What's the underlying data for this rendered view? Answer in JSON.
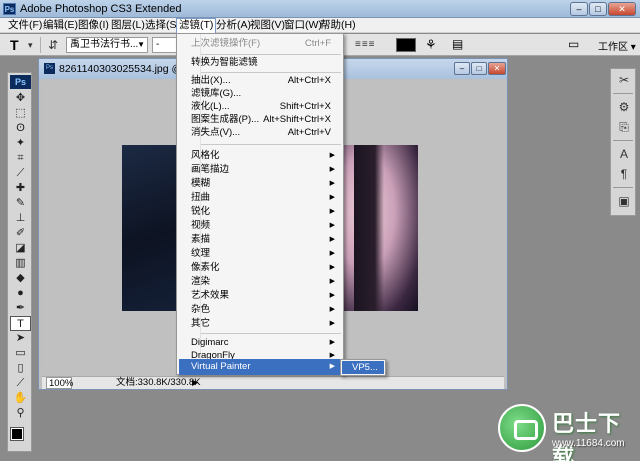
{
  "app": {
    "logo": "Ps",
    "title": "Adobe Photoshop CS3 Extended",
    "window_buttons": {
      "minimize": "–",
      "maximize": "□",
      "close": "✕"
    }
  },
  "menubar": {
    "items": [
      "文件(F)",
      "编辑(E)",
      "图像(I)",
      "图层(L)",
      "选择(S)",
      "滤镜(T)",
      "分析(A)",
      "视图(V)",
      "窗口(W)",
      "帮助(H)"
    ],
    "active_index": 5
  },
  "options_bar": {
    "tool_icon": "T",
    "font_family": "禹卫书法行书...",
    "font_style": "-",
    "workspace_label": "工作区",
    "text_color": "#000000"
  },
  "document": {
    "icon": "Ps",
    "title": "8261140303025534.jpg @ 100%",
    "zoom": "100%",
    "doc_size": "文档:330.8K/330.8K",
    "buttons": {
      "minimize": "–",
      "maximize": "□",
      "close": "✕"
    }
  },
  "filter_menu": {
    "last_filter": {
      "label": "上次滤镜操作(F)",
      "shortcut": "Ctrl+F"
    },
    "convert_smart": "转换为智能滤镜",
    "group1": [
      {
        "label": "抽出(X)...",
        "shortcut": "Alt+Ctrl+X"
      },
      {
        "label": "滤镜库(G)...",
        "shortcut": ""
      },
      {
        "label": "液化(L)...",
        "shortcut": "Shift+Ctrl+X"
      },
      {
        "label": "图案生成器(P)...",
        "shortcut": "Alt+Shift+Ctrl+X"
      },
      {
        "label": "消失点(V)...",
        "shortcut": "Alt+Ctrl+V"
      }
    ],
    "group2": [
      "风格化",
      "画笔描边",
      "模糊",
      "扭曲",
      "锐化",
      "视频",
      "素描",
      "纹理",
      "像素化",
      "渲染",
      "艺术效果",
      "杂色",
      "其它"
    ],
    "group3": [
      "Digimarc",
      "DragonFly",
      "Virtual Painter"
    ],
    "highlighted": "Virtual Painter"
  },
  "submenu": {
    "item": "VP5..."
  },
  "watermark": {
    "brand": "巴士下载",
    "url": "www.11684.com"
  }
}
